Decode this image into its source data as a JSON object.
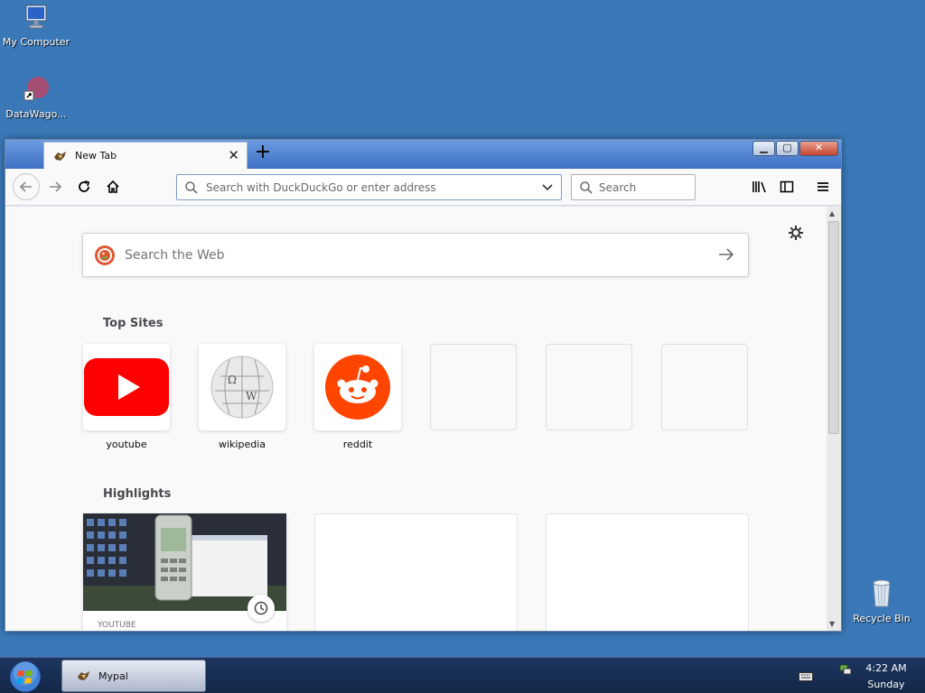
{
  "desktop": {
    "icons": [
      {
        "label": "My Computer"
      },
      {
        "label": "DataWago..."
      },
      {
        "label": "Recycle Bin"
      }
    ]
  },
  "browser": {
    "tab": {
      "title": "New Tab"
    },
    "url_bar": {
      "placeholder": "Search with DuckDuckGo or enter address"
    },
    "search_bar": {
      "placeholder": "Search"
    },
    "page": {
      "web_search_placeholder": "Search the Web",
      "top_sites_title": "Top Sites",
      "top_sites": [
        {
          "label": "youtube",
          "color": "#ff0000"
        },
        {
          "label": "wikipedia"
        },
        {
          "label": "reddit",
          "color": "#ff4500"
        }
      ],
      "highlights_title": "Highlights",
      "highlights": [
        {
          "source": "YOUTUBE"
        }
      ]
    }
  },
  "taskbar": {
    "task_label": "Mypal",
    "clock_time": "4:22 AM",
    "clock_day": "Sunday"
  }
}
